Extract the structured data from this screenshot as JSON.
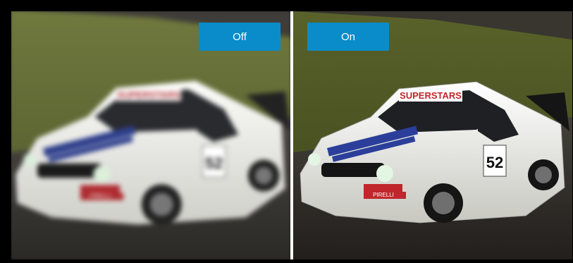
{
  "comparison": {
    "left": {
      "label": "Off",
      "state": "blurred"
    },
    "right": {
      "label": "On",
      "state": "sharp"
    }
  },
  "car": {
    "livery_text": "SUPERSTARS",
    "number": "52",
    "sponsor": "PIRELLI",
    "colors": {
      "body": "#f1f1ee",
      "stripe_blue": "#2b3f9a",
      "grass": "#5f6b2c",
      "track": "#3c3a36"
    }
  },
  "icons": {
    "compare": "before-after-divider"
  }
}
